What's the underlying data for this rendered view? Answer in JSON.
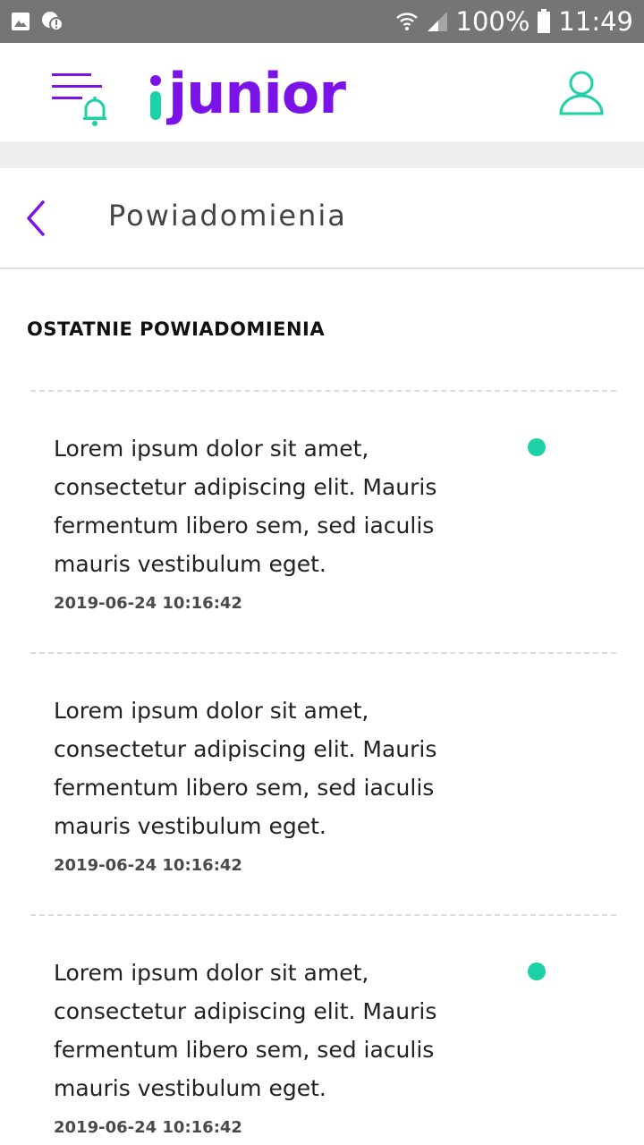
{
  "status_bar": {
    "battery": "100%",
    "time": "11:49"
  },
  "app": {
    "logo_text": "junior",
    "brand_color": "#7b12e8",
    "accent_color": "#1bd1a5"
  },
  "page": {
    "title": "Powiadomienia",
    "section_title": "OSTATNIE POWIADOMIENIA"
  },
  "notifications": [
    {
      "text": "Lorem ipsum dolor sit amet, consectetur adipiscing elit. Mauris fermentum libero sem, sed iaculis mauris vestibulum eget.",
      "date": "2019-06-24 10:16:42",
      "unread": true
    },
    {
      "text": "Lorem ipsum dolor sit amet, consectetur adipiscing elit. Mauris fermentum libero sem, sed iaculis mauris vestibulum eget.",
      "date": "2019-06-24 10:16:42",
      "unread": false
    },
    {
      "text": "Lorem ipsum dolor sit amet, consectetur adipiscing elit. Mauris fermentum libero sem, sed iaculis mauris vestibulum eget.",
      "date": "2019-06-24 10:16:42",
      "unread": true
    }
  ]
}
